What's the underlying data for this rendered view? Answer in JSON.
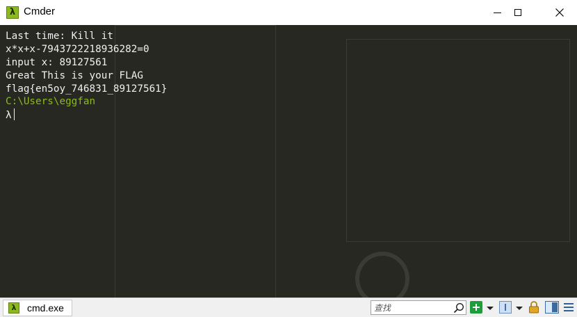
{
  "window": {
    "title": "Cmder",
    "app_icon_glyph": "λ",
    "controls": [
      "minimize-icon",
      "maximize-icon",
      "close-icon"
    ]
  },
  "terminal": {
    "lines": [
      "Last time: Kill it",
      "x*x+x-7943722218936282=0",
      "input x: 89127561",
      "Great This is your FLAG",
      "flag{en5oy_746831_89127561}"
    ],
    "path": "C:\\Users\\eggfan",
    "prompt": "λ",
    "colors": {
      "background": "#272822",
      "text": "#f0f0f0",
      "path": "#8cba1e"
    }
  },
  "statusbar": {
    "tab_label": "cmd.exe",
    "tab_icon_glyph": "λ",
    "search_placeholder": "查找",
    "icons": [
      "search-icon",
      "new-console-icon",
      "dropdown-arrow-icon",
      "document-icon",
      "dropdown-arrow-icon",
      "lock-icon",
      "split-view-icon",
      "menu-icon"
    ]
  }
}
